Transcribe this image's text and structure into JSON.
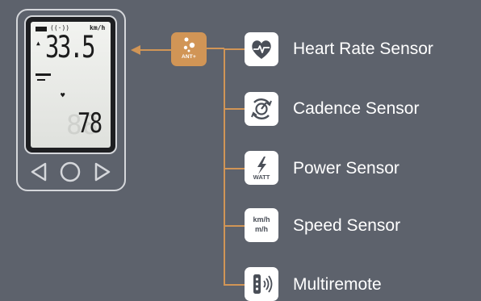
{
  "device": {
    "screen": {
      "unit": "km/h",
      "speed": "33.5",
      "heart_rate": "78",
      "ghost_digits": "88"
    },
    "buttons": [
      "left-arrow",
      "circle",
      "right-arrow"
    ]
  },
  "ant_badge": {
    "label": "ANT+"
  },
  "sensors": [
    {
      "label": "Heart Rate Sensor",
      "icon": "heart-rate-icon"
    },
    {
      "label": "Cadence Sensor",
      "icon": "cadence-icon"
    },
    {
      "label": "Power Sensor",
      "icon": "power-icon",
      "icon_text": "WATT"
    },
    {
      "label": "Speed Sensor",
      "icon": "speed-icon",
      "icon_text_top": "km/h",
      "icon_text_bottom": "m/h"
    },
    {
      "label": "Multiremote",
      "icon": "multiremote-icon"
    }
  ],
  "colors": {
    "background": "#5d626c",
    "accent": "#d19556",
    "text": "#ffffff",
    "icon_fg": "#4a4f58"
  }
}
